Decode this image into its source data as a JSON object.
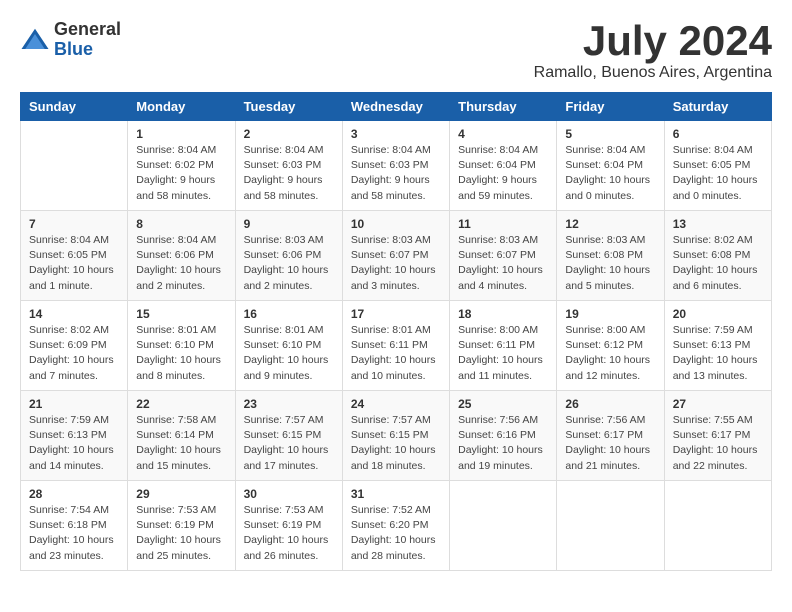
{
  "header": {
    "logo_general": "General",
    "logo_blue": "Blue",
    "month_title": "July 2024",
    "location": "Ramallo, Buenos Aires, Argentina"
  },
  "days_of_week": [
    "Sunday",
    "Monday",
    "Tuesday",
    "Wednesday",
    "Thursday",
    "Friday",
    "Saturday"
  ],
  "weeks": [
    [
      {
        "day": "",
        "info": ""
      },
      {
        "day": "1",
        "info": "Sunrise: 8:04 AM\nSunset: 6:02 PM\nDaylight: 9 hours\nand 58 minutes."
      },
      {
        "day": "2",
        "info": "Sunrise: 8:04 AM\nSunset: 6:03 PM\nDaylight: 9 hours\nand 58 minutes."
      },
      {
        "day": "3",
        "info": "Sunrise: 8:04 AM\nSunset: 6:03 PM\nDaylight: 9 hours\nand 58 minutes."
      },
      {
        "day": "4",
        "info": "Sunrise: 8:04 AM\nSunset: 6:04 PM\nDaylight: 9 hours\nand 59 minutes."
      },
      {
        "day": "5",
        "info": "Sunrise: 8:04 AM\nSunset: 6:04 PM\nDaylight: 10 hours\nand 0 minutes."
      },
      {
        "day": "6",
        "info": "Sunrise: 8:04 AM\nSunset: 6:05 PM\nDaylight: 10 hours\nand 0 minutes."
      }
    ],
    [
      {
        "day": "7",
        "info": "Sunrise: 8:04 AM\nSunset: 6:05 PM\nDaylight: 10 hours\nand 1 minute."
      },
      {
        "day": "8",
        "info": "Sunrise: 8:04 AM\nSunset: 6:06 PM\nDaylight: 10 hours\nand 2 minutes."
      },
      {
        "day": "9",
        "info": "Sunrise: 8:03 AM\nSunset: 6:06 PM\nDaylight: 10 hours\nand 2 minutes."
      },
      {
        "day": "10",
        "info": "Sunrise: 8:03 AM\nSunset: 6:07 PM\nDaylight: 10 hours\nand 3 minutes."
      },
      {
        "day": "11",
        "info": "Sunrise: 8:03 AM\nSunset: 6:07 PM\nDaylight: 10 hours\nand 4 minutes."
      },
      {
        "day": "12",
        "info": "Sunrise: 8:03 AM\nSunset: 6:08 PM\nDaylight: 10 hours\nand 5 minutes."
      },
      {
        "day": "13",
        "info": "Sunrise: 8:02 AM\nSunset: 6:08 PM\nDaylight: 10 hours\nand 6 minutes."
      }
    ],
    [
      {
        "day": "14",
        "info": "Sunrise: 8:02 AM\nSunset: 6:09 PM\nDaylight: 10 hours\nand 7 minutes."
      },
      {
        "day": "15",
        "info": "Sunrise: 8:01 AM\nSunset: 6:10 PM\nDaylight: 10 hours\nand 8 minutes."
      },
      {
        "day": "16",
        "info": "Sunrise: 8:01 AM\nSunset: 6:10 PM\nDaylight: 10 hours\nand 9 minutes."
      },
      {
        "day": "17",
        "info": "Sunrise: 8:01 AM\nSunset: 6:11 PM\nDaylight: 10 hours\nand 10 minutes."
      },
      {
        "day": "18",
        "info": "Sunrise: 8:00 AM\nSunset: 6:11 PM\nDaylight: 10 hours\nand 11 minutes."
      },
      {
        "day": "19",
        "info": "Sunrise: 8:00 AM\nSunset: 6:12 PM\nDaylight: 10 hours\nand 12 minutes."
      },
      {
        "day": "20",
        "info": "Sunrise: 7:59 AM\nSunset: 6:13 PM\nDaylight: 10 hours\nand 13 minutes."
      }
    ],
    [
      {
        "day": "21",
        "info": "Sunrise: 7:59 AM\nSunset: 6:13 PM\nDaylight: 10 hours\nand 14 minutes."
      },
      {
        "day": "22",
        "info": "Sunrise: 7:58 AM\nSunset: 6:14 PM\nDaylight: 10 hours\nand 15 minutes."
      },
      {
        "day": "23",
        "info": "Sunrise: 7:57 AM\nSunset: 6:15 PM\nDaylight: 10 hours\nand 17 minutes."
      },
      {
        "day": "24",
        "info": "Sunrise: 7:57 AM\nSunset: 6:15 PM\nDaylight: 10 hours\nand 18 minutes."
      },
      {
        "day": "25",
        "info": "Sunrise: 7:56 AM\nSunset: 6:16 PM\nDaylight: 10 hours\nand 19 minutes."
      },
      {
        "day": "26",
        "info": "Sunrise: 7:56 AM\nSunset: 6:17 PM\nDaylight: 10 hours\nand 21 minutes."
      },
      {
        "day": "27",
        "info": "Sunrise: 7:55 AM\nSunset: 6:17 PM\nDaylight: 10 hours\nand 22 minutes."
      }
    ],
    [
      {
        "day": "28",
        "info": "Sunrise: 7:54 AM\nSunset: 6:18 PM\nDaylight: 10 hours\nand 23 minutes."
      },
      {
        "day": "29",
        "info": "Sunrise: 7:53 AM\nSunset: 6:19 PM\nDaylight: 10 hours\nand 25 minutes."
      },
      {
        "day": "30",
        "info": "Sunrise: 7:53 AM\nSunset: 6:19 PM\nDaylight: 10 hours\nand 26 minutes."
      },
      {
        "day": "31",
        "info": "Sunrise: 7:52 AM\nSunset: 6:20 PM\nDaylight: 10 hours\nand 28 minutes."
      },
      {
        "day": "",
        "info": ""
      },
      {
        "day": "",
        "info": ""
      },
      {
        "day": "",
        "info": ""
      }
    ]
  ]
}
